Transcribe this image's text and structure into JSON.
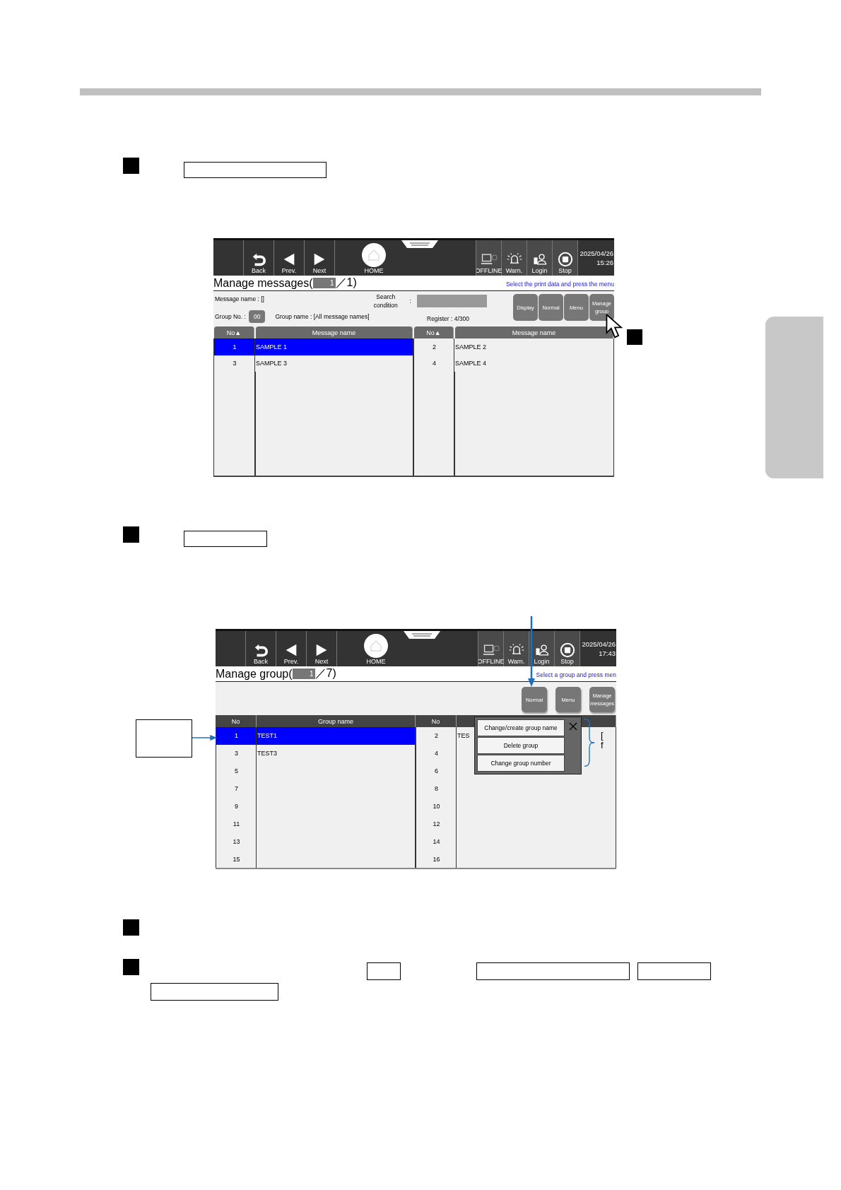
{
  "screens": [
    {
      "toolbar": {
        "nav": [
          {
            "kind": "back",
            "label": "Back"
          },
          {
            "kind": "prev",
            "label": "Prev."
          },
          {
            "kind": "next",
            "label": "Next"
          }
        ],
        "home": "HOME",
        "status": [
          {
            "kind": "offline",
            "label": "OFFLINE"
          },
          {
            "kind": "warn",
            "label": "Warn."
          },
          {
            "kind": "login",
            "label": "Login"
          },
          {
            "kind": "stop",
            "label": "Stop"
          }
        ],
        "date": "2025/04/26",
        "time": "15:26"
      },
      "title": "Manage messages(",
      "page_field": "1",
      "page_total": "／1)",
      "hint": "Select the print data and press the menu",
      "info": {
        "message_name": "Message name :  []",
        "search_label": "Search condition",
        "search_colon": ":",
        "group_no_label": "Group No. :",
        "group_no_value": "00",
        "group_name": "Group name : [All message names]",
        "register": "Register : 4/300"
      },
      "buttons": [
        {
          "label": "Display"
        },
        {
          "label": "Normal"
        },
        {
          "label": "Menu"
        },
        {
          "label": "Manage group"
        }
      ],
      "table": {
        "columns": [
          "No▲",
          "Message name",
          "No▲",
          "Message name"
        ],
        "items": [
          {
            "no": "1",
            "name": "SAMPLE 1",
            "selected": true
          },
          {
            "no": "2",
            "name": "SAMPLE 2",
            "selected": false
          },
          {
            "no": "3",
            "name": "SAMPLE 3",
            "selected": false
          },
          {
            "no": "4",
            "name": "SAMPLE 4",
            "selected": false
          }
        ]
      }
    },
    {
      "toolbar": {
        "nav": [
          {
            "kind": "back",
            "label": "Back"
          },
          {
            "kind": "prev",
            "label": "Prev."
          },
          {
            "kind": "next",
            "label": "Next"
          }
        ],
        "home": "HOME",
        "status": [
          {
            "kind": "offline",
            "label": "OFFLINE"
          },
          {
            "kind": "warn",
            "label": "Warn."
          },
          {
            "kind": "login",
            "label": "Login"
          },
          {
            "kind": "stop",
            "label": "Stop"
          }
        ],
        "date": "2025/04/26",
        "time": "17:43"
      },
      "title": "Manage group(",
      "page_field": "1",
      "page_total": "／7)",
      "hint": "Select a group and press men",
      "buttons": [
        {
          "label": "Normal"
        },
        {
          "label": "Menu"
        },
        {
          "label": "Manage messages"
        }
      ],
      "table": {
        "columns": [
          "No",
          "Group name",
          "No"
        ],
        "items": [
          {
            "no": "1",
            "name": "TEST1",
            "selected": true
          },
          {
            "no": "2",
            "name": "TES",
            "selected": false
          },
          {
            "no": "3",
            "name": "TEST3",
            "selected": false
          },
          {
            "no": "4",
            "selected": false
          },
          {
            "no": "5",
            "selected": false
          },
          {
            "no": "6",
            "selected": false
          },
          {
            "no": "7",
            "selected": false
          },
          {
            "no": "8",
            "selected": false
          },
          {
            "no": "9",
            "selected": false
          },
          {
            "no": "10",
            "selected": false
          },
          {
            "no": "11",
            "selected": false
          },
          {
            "no": "12",
            "selected": false
          },
          {
            "no": "13",
            "selected": false
          },
          {
            "no": "14",
            "selected": false
          },
          {
            "no": "15",
            "selected": false
          },
          {
            "no": "16",
            "selected": false
          }
        ]
      },
      "popup": {
        "items": [
          "Change/create group name",
          "Delete group",
          "Change group number"
        ]
      },
      "callout_fragments": [
        "[",
        "f"
      ]
    }
  ]
}
